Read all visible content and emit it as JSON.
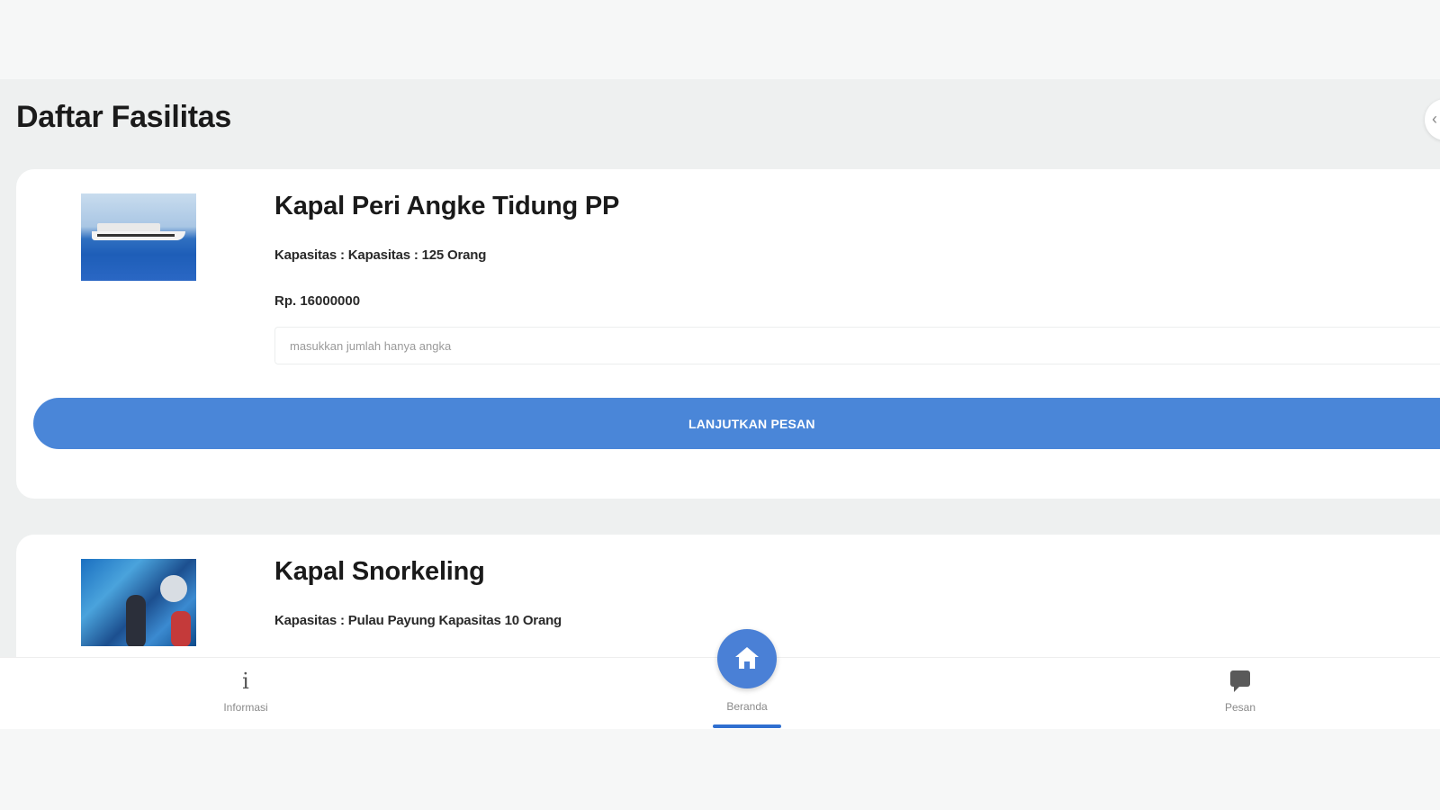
{
  "page": {
    "title": "Daftar Fasilitas"
  },
  "facilities": [
    {
      "name": "Kapal Peri Angke Tidung PP",
      "capacity": "Kapasitas : Kapasitas : 125 Orang",
      "price": "Rp. 16000000",
      "image_icon": "ferry-photo",
      "quantity_placeholder": "masukkan jumlah hanya angka",
      "quantity_value": "",
      "order_button_label": "LANJUTKAN PESAN"
    },
    {
      "name": "Kapal Snorkeling",
      "capacity": "Kapasitas : Pulau Payung Kapasitas 10 Orang",
      "image_icon": "snorkeling-photo"
    }
  ],
  "bottom_nav": {
    "items": [
      {
        "label": "Informasi",
        "icon": "info-icon",
        "glyph": "i"
      },
      {
        "label": "Beranda",
        "icon": "home-icon",
        "active": true
      },
      {
        "label": "Pesan",
        "icon": "chat-icon"
      }
    ]
  },
  "colors": {
    "primary": "#4a86d8",
    "active_indicator": "#2f6fd0",
    "background": "#eef0f0",
    "card": "#ffffff"
  }
}
